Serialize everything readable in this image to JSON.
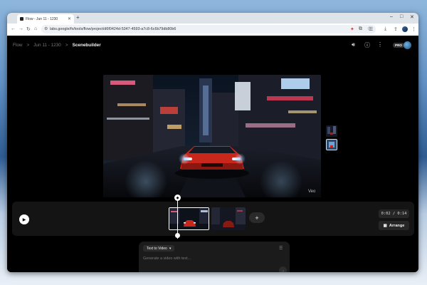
{
  "browser": {
    "tab_title": "Flow - Jun 11 - 1230",
    "new_tab": "+",
    "url": "labs.google/fx/tools/flow/project/d6f0424d-5347-4593-a7c8-6c6b79db80b6",
    "window_controls": [
      "–",
      "□",
      "✕"
    ],
    "nav_icons": [
      "arrow-left-icon",
      "arrow-right-icon",
      "reload-icon",
      "home-icon"
    ]
  },
  "app": {
    "breadcrumb": [
      "Flow",
      "Jun 11 - 1230",
      "Scenebuilder"
    ],
    "separator": ">",
    "pro_badge": "PRO",
    "video_watermark": "Veo",
    "timer": "0:02 / 0:14",
    "arrange_label": "Arrange",
    "add_clip": "+",
    "prompt": {
      "mode": "Text to Video",
      "placeholder": "Generate a video with text..."
    },
    "colors": {
      "background": "#000000",
      "panel": "#141414",
      "car": "#c9271b",
      "accent_light": "#cfe6ff"
    }
  }
}
